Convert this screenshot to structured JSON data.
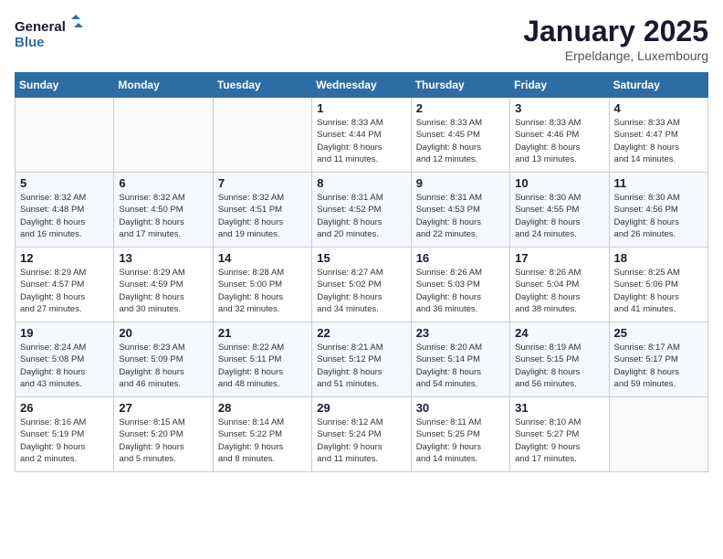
{
  "logo": {
    "line1": "General",
    "line2": "Blue"
  },
  "title": "January 2025",
  "location": "Erpeldange, Luxembourg",
  "days_of_week": [
    "Sunday",
    "Monday",
    "Tuesday",
    "Wednesday",
    "Thursday",
    "Friday",
    "Saturday"
  ],
  "weeks": [
    [
      {
        "num": "",
        "info": ""
      },
      {
        "num": "",
        "info": ""
      },
      {
        "num": "",
        "info": ""
      },
      {
        "num": "1",
        "info": "Sunrise: 8:33 AM\nSunset: 4:44 PM\nDaylight: 8 hours\nand 11 minutes."
      },
      {
        "num": "2",
        "info": "Sunrise: 8:33 AM\nSunset: 4:45 PM\nDaylight: 8 hours\nand 12 minutes."
      },
      {
        "num": "3",
        "info": "Sunrise: 8:33 AM\nSunset: 4:46 PM\nDaylight: 8 hours\nand 13 minutes."
      },
      {
        "num": "4",
        "info": "Sunrise: 8:33 AM\nSunset: 4:47 PM\nDaylight: 8 hours\nand 14 minutes."
      }
    ],
    [
      {
        "num": "5",
        "info": "Sunrise: 8:32 AM\nSunset: 4:48 PM\nDaylight: 8 hours\nand 16 minutes."
      },
      {
        "num": "6",
        "info": "Sunrise: 8:32 AM\nSunset: 4:50 PM\nDaylight: 8 hours\nand 17 minutes."
      },
      {
        "num": "7",
        "info": "Sunrise: 8:32 AM\nSunset: 4:51 PM\nDaylight: 8 hours\nand 19 minutes."
      },
      {
        "num": "8",
        "info": "Sunrise: 8:31 AM\nSunset: 4:52 PM\nDaylight: 8 hours\nand 20 minutes."
      },
      {
        "num": "9",
        "info": "Sunrise: 8:31 AM\nSunset: 4:53 PM\nDaylight: 8 hours\nand 22 minutes."
      },
      {
        "num": "10",
        "info": "Sunrise: 8:30 AM\nSunset: 4:55 PM\nDaylight: 8 hours\nand 24 minutes."
      },
      {
        "num": "11",
        "info": "Sunrise: 8:30 AM\nSunset: 4:56 PM\nDaylight: 8 hours\nand 26 minutes."
      }
    ],
    [
      {
        "num": "12",
        "info": "Sunrise: 8:29 AM\nSunset: 4:57 PM\nDaylight: 8 hours\nand 27 minutes."
      },
      {
        "num": "13",
        "info": "Sunrise: 8:29 AM\nSunset: 4:59 PM\nDaylight: 8 hours\nand 30 minutes."
      },
      {
        "num": "14",
        "info": "Sunrise: 8:28 AM\nSunset: 5:00 PM\nDaylight: 8 hours\nand 32 minutes."
      },
      {
        "num": "15",
        "info": "Sunrise: 8:27 AM\nSunset: 5:02 PM\nDaylight: 8 hours\nand 34 minutes."
      },
      {
        "num": "16",
        "info": "Sunrise: 8:26 AM\nSunset: 5:03 PM\nDaylight: 8 hours\nand 36 minutes."
      },
      {
        "num": "17",
        "info": "Sunrise: 8:26 AM\nSunset: 5:04 PM\nDaylight: 8 hours\nand 38 minutes."
      },
      {
        "num": "18",
        "info": "Sunrise: 8:25 AM\nSunset: 5:06 PM\nDaylight: 8 hours\nand 41 minutes."
      }
    ],
    [
      {
        "num": "19",
        "info": "Sunrise: 8:24 AM\nSunset: 5:08 PM\nDaylight: 8 hours\nand 43 minutes."
      },
      {
        "num": "20",
        "info": "Sunrise: 8:23 AM\nSunset: 5:09 PM\nDaylight: 8 hours\nand 46 minutes."
      },
      {
        "num": "21",
        "info": "Sunrise: 8:22 AM\nSunset: 5:11 PM\nDaylight: 8 hours\nand 48 minutes."
      },
      {
        "num": "22",
        "info": "Sunrise: 8:21 AM\nSunset: 5:12 PM\nDaylight: 8 hours\nand 51 minutes."
      },
      {
        "num": "23",
        "info": "Sunrise: 8:20 AM\nSunset: 5:14 PM\nDaylight: 8 hours\nand 54 minutes."
      },
      {
        "num": "24",
        "info": "Sunrise: 8:19 AM\nSunset: 5:15 PM\nDaylight: 8 hours\nand 56 minutes."
      },
      {
        "num": "25",
        "info": "Sunrise: 8:17 AM\nSunset: 5:17 PM\nDaylight: 8 hours\nand 59 minutes."
      }
    ],
    [
      {
        "num": "26",
        "info": "Sunrise: 8:16 AM\nSunset: 5:19 PM\nDaylight: 9 hours\nand 2 minutes."
      },
      {
        "num": "27",
        "info": "Sunrise: 8:15 AM\nSunset: 5:20 PM\nDaylight: 9 hours\nand 5 minutes."
      },
      {
        "num": "28",
        "info": "Sunrise: 8:14 AM\nSunset: 5:22 PM\nDaylight: 9 hours\nand 8 minutes."
      },
      {
        "num": "29",
        "info": "Sunrise: 8:12 AM\nSunset: 5:24 PM\nDaylight: 9 hours\nand 11 minutes."
      },
      {
        "num": "30",
        "info": "Sunrise: 8:11 AM\nSunset: 5:25 PM\nDaylight: 9 hours\nand 14 minutes."
      },
      {
        "num": "31",
        "info": "Sunrise: 8:10 AM\nSunset: 5:27 PM\nDaylight: 9 hours\nand 17 minutes."
      },
      {
        "num": "",
        "info": ""
      }
    ]
  ]
}
